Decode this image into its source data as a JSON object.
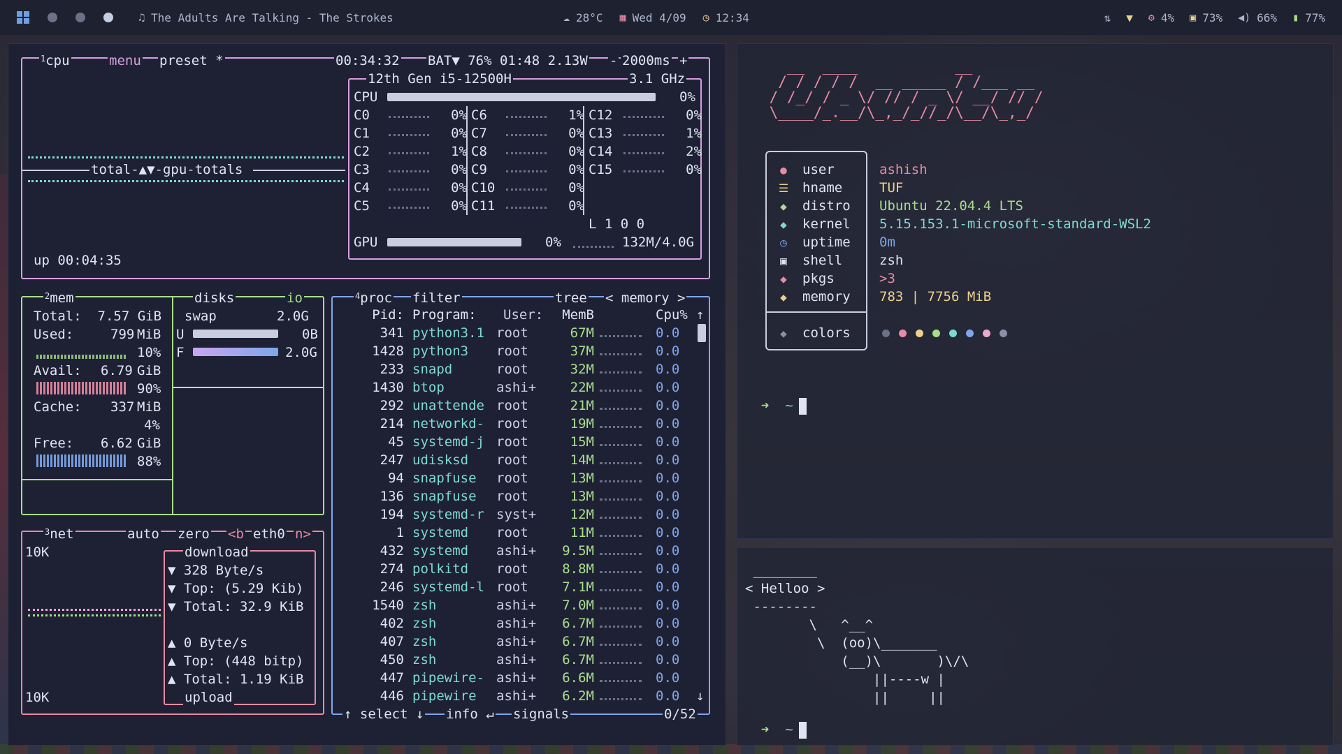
{
  "topbar": {
    "now_playing": "The Adults Are Talking - The Strokes",
    "weather": "28°C",
    "date": "Wed 4/09",
    "time": "12:34",
    "cpu": "4%",
    "disk": "73%",
    "volume": "66%",
    "battery": "77%"
  },
  "btop": {
    "cpu": {
      "title": "cpu",
      "num": "1",
      "menu": "menu",
      "preset": "preset *",
      "clock": "00:34:32",
      "battery": "BAT▼ 76% 01:48 2.13W",
      "interval": "2000ms",
      "plus": "+",
      "minus": "-",
      "model": "12th Gen i5-12500H",
      "freq": "3.1 GHz",
      "total_label": "CPU",
      "total_pct": "0%",
      "graph_label": "total-▲▼-gpu-totals",
      "uptime": "up 00:04:35",
      "load": "L 1 0 0",
      "gpu_label": "GPU",
      "gpu_pct": "0%",
      "gpu_mem": "132M/4.0G",
      "cores": [
        {
          "name": "C0",
          "pct": "0%"
        },
        {
          "name": "C1",
          "pct": "0%"
        },
        {
          "name": "C2",
          "pct": "1%"
        },
        {
          "name": "C3",
          "pct": "0%"
        },
        {
          "name": "C4",
          "pct": "0%"
        },
        {
          "name": "C5",
          "pct": "0%"
        },
        {
          "name": "C6",
          "pct": "1%"
        },
        {
          "name": "C7",
          "pct": "0%"
        },
        {
          "name": "C8",
          "pct": "0%"
        },
        {
          "name": "C9",
          "pct": "0%"
        },
        {
          "name": "C10",
          "pct": "0%"
        },
        {
          "name": "C11",
          "pct": "0%"
        },
        {
          "name": "C12",
          "pct": "0%"
        },
        {
          "name": "C13",
          "pct": "1%"
        },
        {
          "name": "C14",
          "pct": "2%"
        },
        {
          "name": "C15",
          "pct": "0%"
        }
      ]
    },
    "mem": {
      "num": "2",
      "title": "mem",
      "disks": "disks",
      "io": "io",
      "total": "Total:  7.57 GiB",
      "used": "Used:",
      "used_val": "799",
      "used_unit": "MiB",
      "used_pct": "10%",
      "avail": "Avail:",
      "avail_val": "6.79",
      "avail_unit": "GiB",
      "avail_pct": "90%",
      "cache": "Cache:",
      "cache_val": "337",
      "cache_unit": "MiB",
      "cache_pct": "4%",
      "free": "Free:",
      "free_val": "6.62",
      "free_unit": "GiB",
      "free_pct": "88%",
      "swap": "swap",
      "swap_size": "2.0G",
      "u_label": "U",
      "u_val": "0B",
      "f_label": "F",
      "f_val": "2.0G",
      "used_fraction": 0.1,
      "avail_fraction": 0.9,
      "free_fraction": 0.88
    },
    "net": {
      "num": "3",
      "title": "net",
      "auto": "auto",
      "zero": "zero",
      "iface_prev": "<b",
      "iface": "eth0",
      "iface_next": "n>",
      "scale_top": "10K",
      "scale_bottom": "10K",
      "download": "download",
      "dl_rate": "▼ 328 Byte/s",
      "dl_top": "▼ Top: (5.29 Kib)",
      "dl_total": "▼ Total: 32.9 KiB",
      "ul_rate": "▲ 0 Byte/s",
      "ul_top": "▲ Top: (448 bitp)",
      "ul_total": "▲ Total: 1.19 KiB",
      "upload": "upload"
    },
    "proc": {
      "num": "4",
      "title": "proc",
      "filter": "filter",
      "tree": "tree",
      "sort": "< memory >",
      "headers": {
        "pid": "Pid:",
        "program": "Program:",
        "user": "User:",
        "mem": "MemB",
        "cpu": "Cpu%"
      },
      "rows": [
        {
          "pid": "341",
          "program": "python3.1",
          "user": "root",
          "mem": "67M",
          "cpu": "0.0"
        },
        {
          "pid": "1428",
          "program": "python3",
          "user": "root",
          "mem": "37M",
          "cpu": "0.0"
        },
        {
          "pid": "233",
          "program": "snapd",
          "user": "root",
          "mem": "32M",
          "cpu": "0.0"
        },
        {
          "pid": "1430",
          "program": "btop",
          "user": "ashi+",
          "mem": "22M",
          "cpu": "0.0"
        },
        {
          "pid": "292",
          "program": "unattende",
          "user": "root",
          "mem": "21M",
          "cpu": "0.0"
        },
        {
          "pid": "214",
          "program": "networkd-",
          "user": "root",
          "mem": "19M",
          "cpu": "0.0"
        },
        {
          "pid": "45",
          "program": "systemd-j",
          "user": "root",
          "mem": "15M",
          "cpu": "0.0"
        },
        {
          "pid": "247",
          "program": "udisksd",
          "user": "root",
          "mem": "14M",
          "cpu": "0.0"
        },
        {
          "pid": "94",
          "program": "snapfuse",
          "user": "root",
          "mem": "13M",
          "cpu": "0.0"
        },
        {
          "pid": "136",
          "program": "snapfuse",
          "user": "root",
          "mem": "13M",
          "cpu": "0.0"
        },
        {
          "pid": "194",
          "program": "systemd-r",
          "user": "syst+",
          "mem": "12M",
          "cpu": "0.0"
        },
        {
          "pid": "1",
          "program": "systemd",
          "user": "root",
          "mem": "11M",
          "cpu": "0.0"
        },
        {
          "pid": "432",
          "program": "systemd",
          "user": "ashi+",
          "mem": "9.5M",
          "cpu": "0.0"
        },
        {
          "pid": "274",
          "program": "polkitd",
          "user": "root",
          "mem": "8.8M",
          "cpu": "0.0"
        },
        {
          "pid": "246",
          "program": "systemd-l",
          "user": "root",
          "mem": "7.1M",
          "cpu": "0.0"
        },
        {
          "pid": "1540",
          "program": "zsh",
          "user": "ashi+",
          "mem": "7.0M",
          "cpu": "0.0"
        },
        {
          "pid": "402",
          "program": "zsh",
          "user": "ashi+",
          "mem": "6.7M",
          "cpu": "0.0"
        },
        {
          "pid": "407",
          "program": "zsh",
          "user": "ashi+",
          "mem": "6.7M",
          "cpu": "0.0"
        },
        {
          "pid": "450",
          "program": "zsh",
          "user": "ashi+",
          "mem": "6.7M",
          "cpu": "0.0"
        },
        {
          "pid": "447",
          "program": "pipewire-",
          "user": "ashi+",
          "mem": "6.6M",
          "cpu": "0.0"
        },
        {
          "pid": "446",
          "program": "pipewire",
          "user": "ashi+",
          "mem": "6.2M",
          "cpu": "0.0"
        }
      ],
      "footer_select": "↑ select ↓",
      "footer_info": "info ↵",
      "footer_signals": "signals",
      "count": "0/52",
      "scroll_up": "↑",
      "scroll_down": "↓"
    }
  },
  "fastfetch": {
    "ascii": "   __  ____           __\n  / / / / /  __ _____ / /___ __\n / /_/ / _ \\/ // / _ \\/ __/ // /\n \\____/_.__/\\_,_/_//_/\\__/\\_,_/",
    "rows": [
      {
        "icon": "person-icon",
        "key": "user",
        "value": "ashish",
        "icon_color": "#e88ba4",
        "value_color": "#e88ba4"
      },
      {
        "icon": "host-icon",
        "key": "hname",
        "value": "TUF",
        "icon_color": "#ecd18c",
        "value_color": "#ecd18c"
      },
      {
        "icon": "distro-icon",
        "key": "distro",
        "value": "Ubuntu 22.04.4 LTS",
        "icon_color": "#a8de8c",
        "value_color": "#a8de8c"
      },
      {
        "icon": "kernel-icon",
        "key": "kernel",
        "value": "5.15.153.1-microsoft-standard-WSL2",
        "icon_color": "#7ed9d1",
        "value_color": "#7ed9d1"
      },
      {
        "icon": "clock-icon",
        "key": "uptime",
        "value": "0m",
        "icon_color": "#7fa6ea",
        "value_color": "#7fa6ea"
      },
      {
        "icon": "terminal-icon",
        "key": "shell",
        "value": "zsh",
        "icon_color": "#dfe4f0",
        "value_color": "#dfe4f0"
      },
      {
        "icon": "package-icon",
        "key": "pkgs",
        "value": ">3",
        "icon_color": "#e88ba4",
        "value_color": "#e88ba4"
      },
      {
        "icon": "memory-icon",
        "key": "memory",
        "value": "783 | 7756 MiB",
        "icon_color": "#ecd18c",
        "value_color": "#ecd18c"
      }
    ],
    "colors_label": "colors",
    "palette": [
      "#6b7288",
      "#e88ba4",
      "#ecd18c",
      "#a8de8c",
      "#7ed9d1",
      "#7fa6ea",
      "#f0a6d0",
      "#8a90a6"
    ]
  },
  "terminal1": {
    "prompt": "➜",
    "cwd": "~"
  },
  "cowsay": {
    "art": " ________\n< Helloo >\n --------\n        \\   ^__^\n         \\  (oo)\\_______\n            (__)\\       )\\/\\\n                ||----w |\n                ||     ||",
    "prompt": "➜",
    "cwd": "~"
  }
}
